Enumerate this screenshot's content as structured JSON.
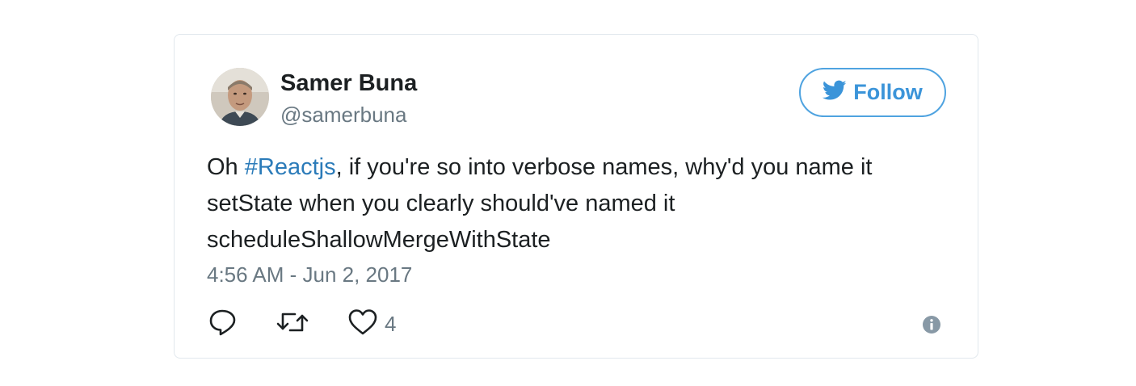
{
  "tweet": {
    "user": {
      "name": "Samer Buna",
      "handle": "@samerbuna"
    },
    "follow_label": "Follow",
    "text": {
      "line1_before": "Oh ",
      "hashtag": "#Reactjs",
      "line1_after": ", if you're so into verbose names, why'd you name it",
      "line2": "setState when you clearly should've named it",
      "line3": "scheduleShallowMergeWithState"
    },
    "timestamp": "4:56 AM - Jun 2, 2017",
    "actions": {
      "like_count": "4"
    },
    "icons": {
      "follow": "twitter-bird-icon",
      "reply": "reply-icon",
      "retweet": "retweet-icon",
      "like": "heart-icon",
      "info": "info-icon"
    },
    "colors": {
      "accent": "#3b94d9",
      "hashtag": "#2b7bb9",
      "secondary_text": "#697882",
      "border": "#e1e8ed",
      "icon_gray": "#8899a6"
    }
  }
}
